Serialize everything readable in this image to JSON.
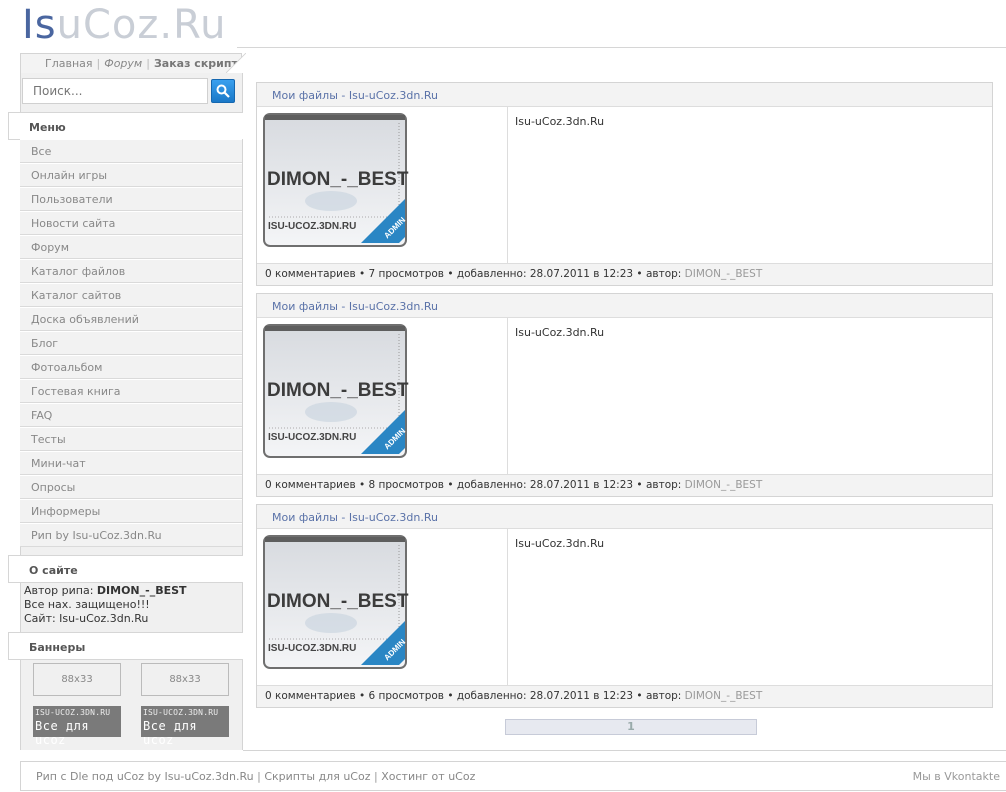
{
  "logo": {
    "part1": "Is",
    "part2": "uCoz.Ru"
  },
  "topnav": {
    "home": "Главная",
    "forum": "Форум",
    "order": "Заказ скрипта"
  },
  "search": {
    "placeholder": "Поиск..."
  },
  "menu": {
    "title": "Меню",
    "items": [
      "Все",
      "Онлайн игры",
      "Пользователи",
      "Новости сайта",
      "Форум",
      "Каталог файлов",
      "Каталог сайтов",
      "Доска объявлений",
      "Блог",
      "Фотоальбом",
      "Гостевая книга",
      "FAQ",
      "Тесты",
      "Мини-чат",
      "Опросы",
      "Информеры",
      "Рип by Isu-uCoz.3dn.Ru"
    ]
  },
  "about": {
    "title": "О сайте",
    "line1_label": "Автор рипа: ",
    "line1_value": "DIMON_-_BEST",
    "line2": "Все нах. защищено!!!",
    "line3": "Сайт: Isu-uCoz.3dn.Ru"
  },
  "banners": {
    "title": "Баннеры",
    "b88_1": "88x33",
    "b88_2": "88x33",
    "uc1_top": "ISU-UCOZ.3DN.RU",
    "uc1_bottom": "Все для ucoz",
    "uc2_top": "ISU-UCOZ.3DN.RU",
    "uc2_bottom": "Все для ucoz"
  },
  "avatar": {
    "name": "DIMON_-_BEST",
    "site": "ISU-UCOZ.3DN.RU",
    "badge": "ADMIN"
  },
  "entries": [
    {
      "title": "Мои файлы - Isu-uCoz.3dn.Ru",
      "text": "Isu-uCoz.3dn.Ru",
      "footer": "0 комментариев • 7 просмотров • добавленно: 28.07.2011 в 12:23 • автор: ",
      "author": "DIMON_-_BEST"
    },
    {
      "title": "Мои файлы - Isu-uCoz.3dn.Ru",
      "text": "Isu-uCoz.3dn.Ru",
      "footer": "0 комментариев • 8 просмотров • добавленно: 28.07.2011 в 12:23 • автор: ",
      "author": "DIMON_-_BEST"
    },
    {
      "title": "Мои файлы - Isu-uCoz.3dn.Ru",
      "text": "Isu-uCoz.3dn.Ru",
      "footer": "0 комментариев • 6 просмотров • добавленно: 28.07.2011 в 12:23 • автор: ",
      "author": "DIMON_-_BEST"
    }
  ],
  "pager": {
    "current": "1"
  },
  "footer": {
    "rip": "Рип с Dle под uCoz by Isu-uCoz.3dn.Ru",
    "scripts": "Скрипты для uCoz",
    "hosting": "Хостинг от uCoz",
    "separator": "|",
    "vk": "Мы в Vkontakte"
  }
}
